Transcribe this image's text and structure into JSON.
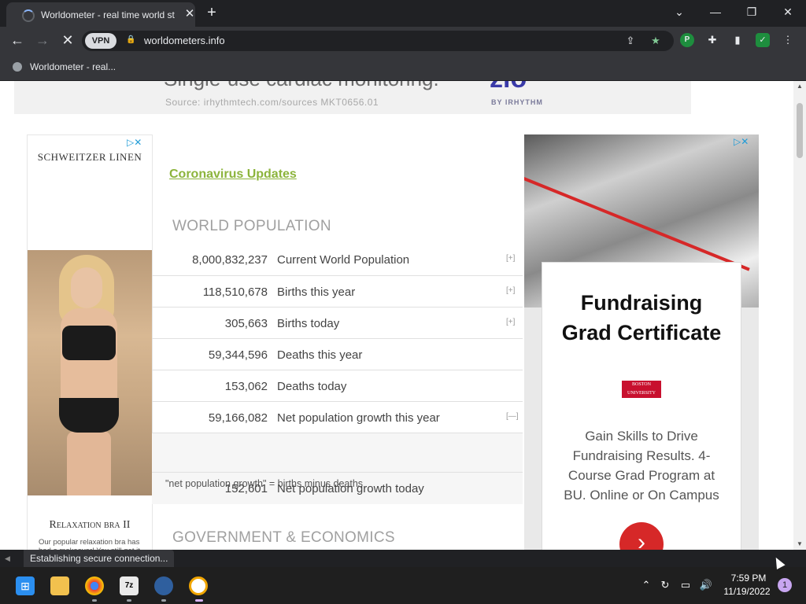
{
  "browser": {
    "tab_title": "Worldometer - real time world st",
    "tab_close": "✕",
    "new_tab": "+",
    "window_controls": {
      "dropdown": "⌄",
      "minimize": "—",
      "restore": "❐",
      "close": "✕"
    },
    "nav": {
      "back": "←",
      "forward": "→",
      "stop": "✕"
    },
    "vpn_label": "VPN",
    "url": "worldometers.info",
    "bookmark": "Worldometer - real...",
    "status": "Establishing secure connection..."
  },
  "top_ad": {
    "headline": "Single-use cardiac monitoring.",
    "source": "Source: irhythmtech.com/sources    MKT0656.01",
    "logo": "zio",
    "brand": "BY IRHYTHM"
  },
  "left_ad": {
    "brand": "SCHWEITZER LINEN",
    "title": "Relaxation bra II",
    "text": "Our popular relaxation bra has had a makeover! You still get it"
  },
  "main": {
    "covid_link": "Coronavirus Updates",
    "world_population_heading": "WORLD POPULATION",
    "government_heading": "GOVERNMENT & ECONOMICS",
    "counters": [
      {
        "value": "8,000,832,237",
        "label": "Current World Population",
        "toggle": "[+]"
      },
      {
        "value": "118,510,678",
        "label": "Births this year",
        "toggle": "[+]"
      },
      {
        "value": "305,663",
        "label": "Births today",
        "toggle": "[+]"
      },
      {
        "value": "59,344,596",
        "label": "Deaths this year",
        "toggle": ""
      },
      {
        "value": "153,062",
        "label": "Deaths today",
        "toggle": ""
      },
      {
        "value": "59,166,082",
        "label": "Net population growth this year",
        "toggle": "[—]"
      },
      {
        "value": "152,601",
        "label": "Net population growth today",
        "toggle": ""
      }
    ],
    "growth_note": "\"net population growth\" = births minus deaths"
  },
  "right_ad": {
    "title_line1": "Fundraising",
    "title_line2": "Grad Certificate",
    "logo": "BOSTON UNIVERSITY",
    "text": "Gain Skills to Drive Fundraising Results. 4-Course Grad Program at BU. Online or On Campus",
    "button": "›"
  },
  "taskbar": {
    "time": "7:59 PM",
    "date": "11/19/2022",
    "notifications": "1"
  }
}
